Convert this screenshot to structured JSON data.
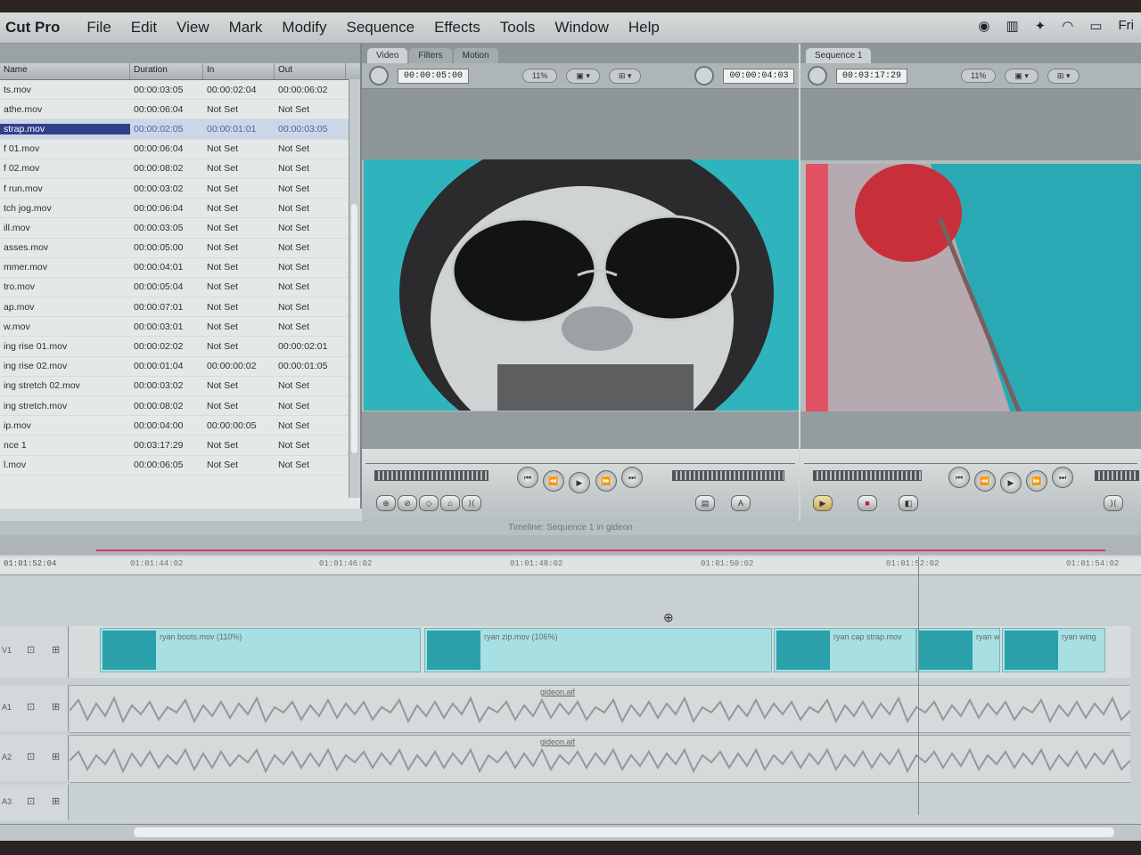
{
  "menubar": {
    "app": "Cut Pro",
    "items": [
      "File",
      "Edit",
      "View",
      "Mark",
      "Modify",
      "Sequence",
      "Effects",
      "Tools",
      "Window",
      "Help"
    ],
    "clock": "Fri"
  },
  "browser": {
    "columns": [
      "Name",
      "Duration",
      "In",
      "Out"
    ],
    "rows": [
      {
        "name": "ts.mov",
        "duration": "00:00:03:05",
        "in": "00:00:02:04",
        "out": "00:00:06:02"
      },
      {
        "name": "athe.mov",
        "duration": "00:00:06:04",
        "in": "Not Set",
        "out": "Not Set"
      },
      {
        "name": "strap.mov",
        "duration": "00:00:02:05",
        "in": "00:00:01:01",
        "out": "00:00:03:05"
      },
      {
        "name": "f 01.mov",
        "duration": "00:00:06:04",
        "in": "Not Set",
        "out": "Not Set"
      },
      {
        "name": "f 02.mov",
        "duration": "00:00:08:02",
        "in": "Not Set",
        "out": "Not Set"
      },
      {
        "name": "f run.mov",
        "duration": "00:00:03:02",
        "in": "Not Set",
        "out": "Not Set"
      },
      {
        "name": "tch jog.mov",
        "duration": "00:00:06:04",
        "in": "Not Set",
        "out": "Not Set"
      },
      {
        "name": "ill.mov",
        "duration": "00:00:03:05",
        "in": "Not Set",
        "out": "Not Set"
      },
      {
        "name": "asses.mov",
        "duration": "00:00:05:00",
        "in": "Not Set",
        "out": "Not Set"
      },
      {
        "name": "mmer.mov",
        "duration": "00:00:04:01",
        "in": "Not Set",
        "out": "Not Set"
      },
      {
        "name": "tro.mov",
        "duration": "00:00:05:04",
        "in": "Not Set",
        "out": "Not Set"
      },
      {
        "name": "ap.mov",
        "duration": "00:00:07:01",
        "in": "Not Set",
        "out": "Not Set"
      },
      {
        "name": "w.mov",
        "duration": "00:00:03:01",
        "in": "Not Set",
        "out": "Not Set"
      },
      {
        "name": "ing rise 01.mov",
        "duration": "00:00:02:02",
        "in": "Not Set",
        "out": "00:00:02:01"
      },
      {
        "name": "ing rise 02.mov",
        "duration": "00:00:01:04",
        "in": "00:00:00:02",
        "out": "00:00:01:05"
      },
      {
        "name": "ing stretch 02.mov",
        "duration": "00:00:03:02",
        "in": "Not Set",
        "out": "Not Set"
      },
      {
        "name": "ing stretch.mov",
        "duration": "00:00:08:02",
        "in": "Not Set",
        "out": "Not Set"
      },
      {
        "name": "ip.mov",
        "duration": "00:00:04:00",
        "in": "00:00:00:05",
        "out": "Not Set"
      },
      {
        "name": "nce 1",
        "duration": "00:03:17:29",
        "in": "Not Set",
        "out": "Not Set"
      },
      {
        "name": "l.mov",
        "duration": "00:00:06:05",
        "in": "Not Set",
        "out": "Not Set"
      }
    ]
  },
  "viewer": {
    "tabs": [
      "Video",
      "Filters",
      "Motion"
    ],
    "duration_tc": "00:00:05:00",
    "zoom": "11%",
    "current_tc": "00:00:04:03"
  },
  "canvas": {
    "tab": "Sequence 1",
    "duration_tc": "00:03:17:29",
    "zoom": "11%"
  },
  "timeline": {
    "title": "Timeline: Sequence 1 in gideon",
    "current_tc": "01:01:52:04",
    "ruler": [
      "01:01:44:02",
      "01:01:46:02",
      "01:01:48:02",
      "01:01:50:02",
      "01:01:52:02",
      "01:01:54:02"
    ],
    "tracks": {
      "v1": "V1",
      "a1": "A1",
      "a2": "A2",
      "a3": "A3"
    },
    "clips": [
      "ryan boots.mov (110%)",
      "ryan zip.mov (106%)",
      "ryan cap strap.mov",
      "ryan w",
      "ryan wing"
    ],
    "audio_label_1": "gideon.aif",
    "audio_label_2": "gideon.aif"
  }
}
